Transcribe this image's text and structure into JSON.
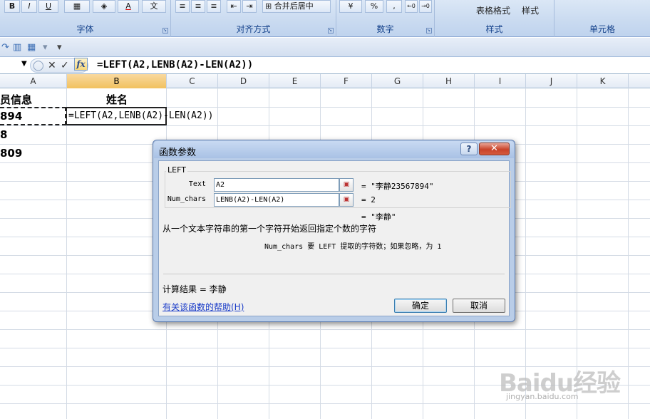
{
  "ribbon": {
    "groups": [
      {
        "label": "字体"
      },
      {
        "label": "对齐方式"
      },
      {
        "label": "数字"
      },
      {
        "label": "样式"
      },
      {
        "label": "单元格"
      }
    ],
    "font_buttons": [
      "B",
      "I",
      "U"
    ],
    "merge_center_label": "合并后居中",
    "number_percent": "%",
    "number_comma": ",",
    "table_format_label": "表格格式",
    "cell_style_label": "样式"
  },
  "formula_bar": {
    "cancel_glyph": "✕",
    "enter_glyph": "✓",
    "fx_label": "fx",
    "formula": "=LEFT(A2,LENB(A2)-LEN(A2))"
  },
  "sheet": {
    "columns": [
      "A",
      "B",
      "C",
      "D",
      "E",
      "F",
      "G",
      "H",
      "I",
      "J",
      "K"
    ],
    "active_column": "B",
    "cells": {
      "A1": "员信息",
      "B1": "姓名",
      "A2": "894",
      "B2": "=LEFT(A2,LENB(A2)-LEN(A2))",
      "A3": "8",
      "A4": "809"
    }
  },
  "dialog": {
    "title": "函数参数",
    "help_glyph": "?",
    "close_glyph": "✕",
    "function_name": "LEFT",
    "args": [
      {
        "name": "Text",
        "value": "A2",
        "result": "= \"李静23567894\""
      },
      {
        "name": "Num_chars",
        "value": "LENB(A2)-LEN(A2)",
        "result": "= 2"
      }
    ],
    "formula_result": "= \"李静\"",
    "function_description": "从一个文本字符串的第一个字符开始返回指定个数的字符",
    "arg_description": "Num_chars  要 LEFT 提取的字符数；如果忽略，为 1",
    "calc_result": "计算结果 =  李静",
    "help_link": "有关该函数的帮助(H)",
    "ok_label": "确定",
    "cancel_label": "取消"
  },
  "watermark": {
    "logo_text": "Baidu经验",
    "sub_text": "jingyan.baidu.com"
  }
}
